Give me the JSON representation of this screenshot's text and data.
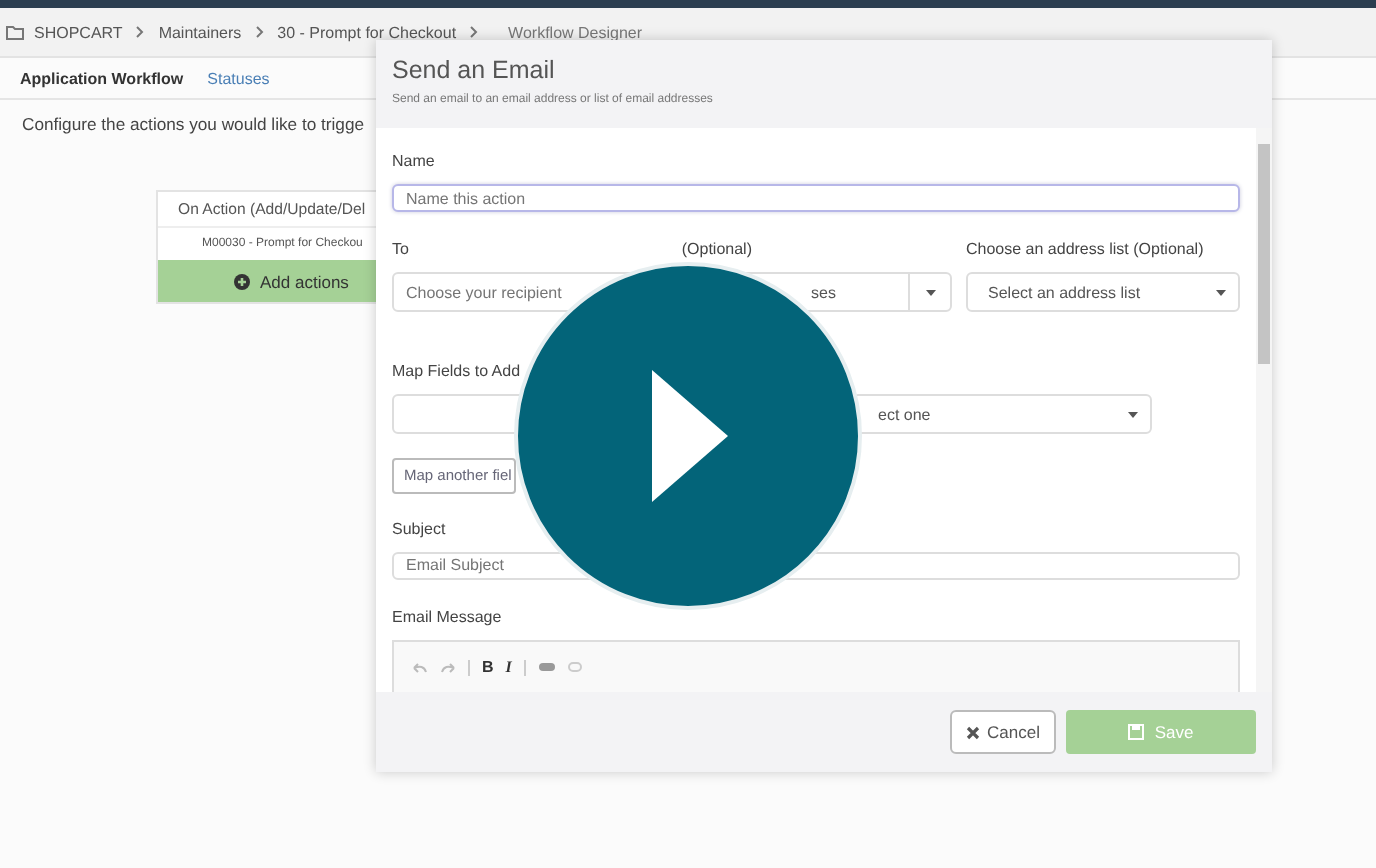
{
  "breadcrumb": [
    {
      "label": "SHOPCART",
      "kind": "home"
    },
    {
      "label": "Maintainers",
      "kind": "link"
    },
    {
      "label": "30 - Prompt for Checkout",
      "kind": "link"
    },
    {
      "label": "Workflow Designer",
      "kind": "current"
    }
  ],
  "tabs": [
    {
      "label": "Application Workflow",
      "selected": true
    },
    {
      "label": "Statuses",
      "selected": false
    }
  ],
  "intro": "Configure the actions you would like to trigge",
  "action_card": {
    "header": "On Action (Add/Update/Del",
    "item": "M00030 - Prompt for Checkou",
    "button": "Add actions"
  },
  "dialog": {
    "title": "Send an Email",
    "subtitle": "Send an email to an email address or list of email addresses",
    "name_label": "Name",
    "name_placeholder": "Name this action",
    "to_label": "To",
    "to_placeholder": "Choose your recipient",
    "cc_label": "(Optional)",
    "cc_value": "ses",
    "list_label": "Choose an address list (Optional)",
    "list_value": "Select an address list",
    "map_label": "Map Fields to Add",
    "map_select": "ect one",
    "map_button": "Map another fiel",
    "subject_label": "Subject",
    "subject_placeholder": "Email Subject",
    "message_label": "Email Message",
    "toolbar": [
      "B",
      "I"
    ],
    "cancel": "Cancel",
    "save": "Save"
  }
}
